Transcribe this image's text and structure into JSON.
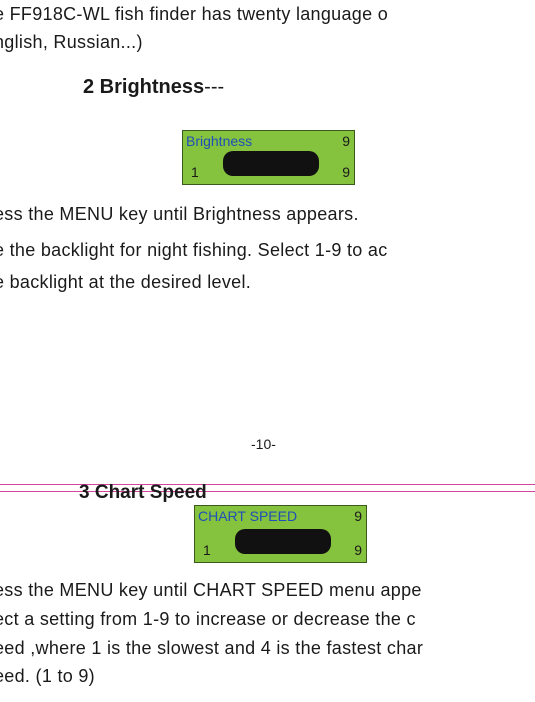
{
  "intro": {
    "line1": "e FF918C-WL fish finder has twenty language o",
    "line2": "nglish, Russian...)"
  },
  "brightness": {
    "heading_num": "2 Brightness",
    "heading_dash": "---",
    "lcd": {
      "title": "Brightness",
      "max": "9",
      "min": "1",
      "value": "9"
    },
    "line1": "ess the MENU key until Brightness appears.",
    "line2": "e the backlight for night fishing. Select 1-9 to ac",
    "line3": "e backlight at the desired level."
  },
  "page_number": "-10-",
  "chart_speed": {
    "heading": "3 Chart Speed",
    "lcd": {
      "title": "CHART SPEED",
      "max": "9",
      "min": "1",
      "value": "9"
    },
    "line1": "ess the MENU key until CHART SPEED menu appe",
    "line2": "ect a setting from 1-9 to increase or decrease the c",
    "line3": "eed ,where 1 is the slowest and 4 is the fastest char",
    "line4": "eed. (1 to 9)"
  },
  "colors": {
    "lcd_green": "#85c23e",
    "lcd_title_blue": "#1f4fb8",
    "rule_pink": "#d4469c"
  }
}
